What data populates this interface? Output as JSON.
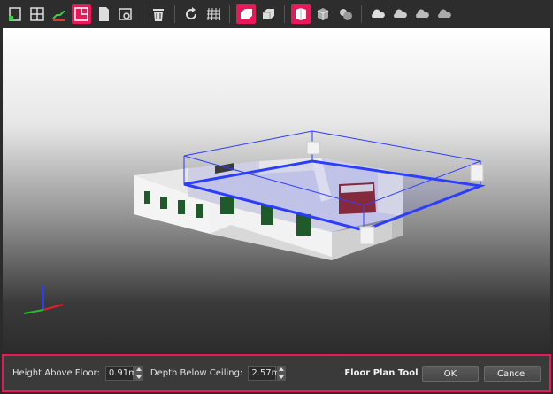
{
  "toolbar": {
    "buttons": [
      {
        "name": "door-tool-icon",
        "active": false
      },
      {
        "name": "window-tool-icon",
        "active": false
      },
      {
        "name": "stairs-tool-icon",
        "active": false
      },
      {
        "name": "floor-plan-tool-icon",
        "active": true
      },
      {
        "name": "page-icon",
        "active": false
      },
      {
        "name": "measure-tool-icon",
        "active": false
      },
      {
        "name": "trash-icon",
        "active": false
      },
      {
        "name": "rotate-icon",
        "active": false
      },
      {
        "name": "grid-icon",
        "active": false
      },
      {
        "name": "solid-view-icon",
        "active": true
      },
      {
        "name": "box-view-icon",
        "active": false
      },
      {
        "name": "material-view-1-icon",
        "active": true
      },
      {
        "name": "material-view-2-icon",
        "active": false
      },
      {
        "name": "material-view-3-icon",
        "active": false
      },
      {
        "name": "cloud-1-icon",
        "active": false
      },
      {
        "name": "cloud-2-icon",
        "active": false
      },
      {
        "name": "cloud-3-icon",
        "active": false
      },
      {
        "name": "cloud-4-icon",
        "active": false
      }
    ]
  },
  "bottom": {
    "height_label": "Height Above Floor:",
    "height_value": "0.91m",
    "depth_label": "Depth Below Ceiling:",
    "depth_value": "2.57m",
    "tool_title": "Floor Plan Tool",
    "ok_label": "OK",
    "cancel_label": "Cancel"
  },
  "colors": {
    "accent": "#e8185a",
    "selection_box": "#2a3cff"
  }
}
